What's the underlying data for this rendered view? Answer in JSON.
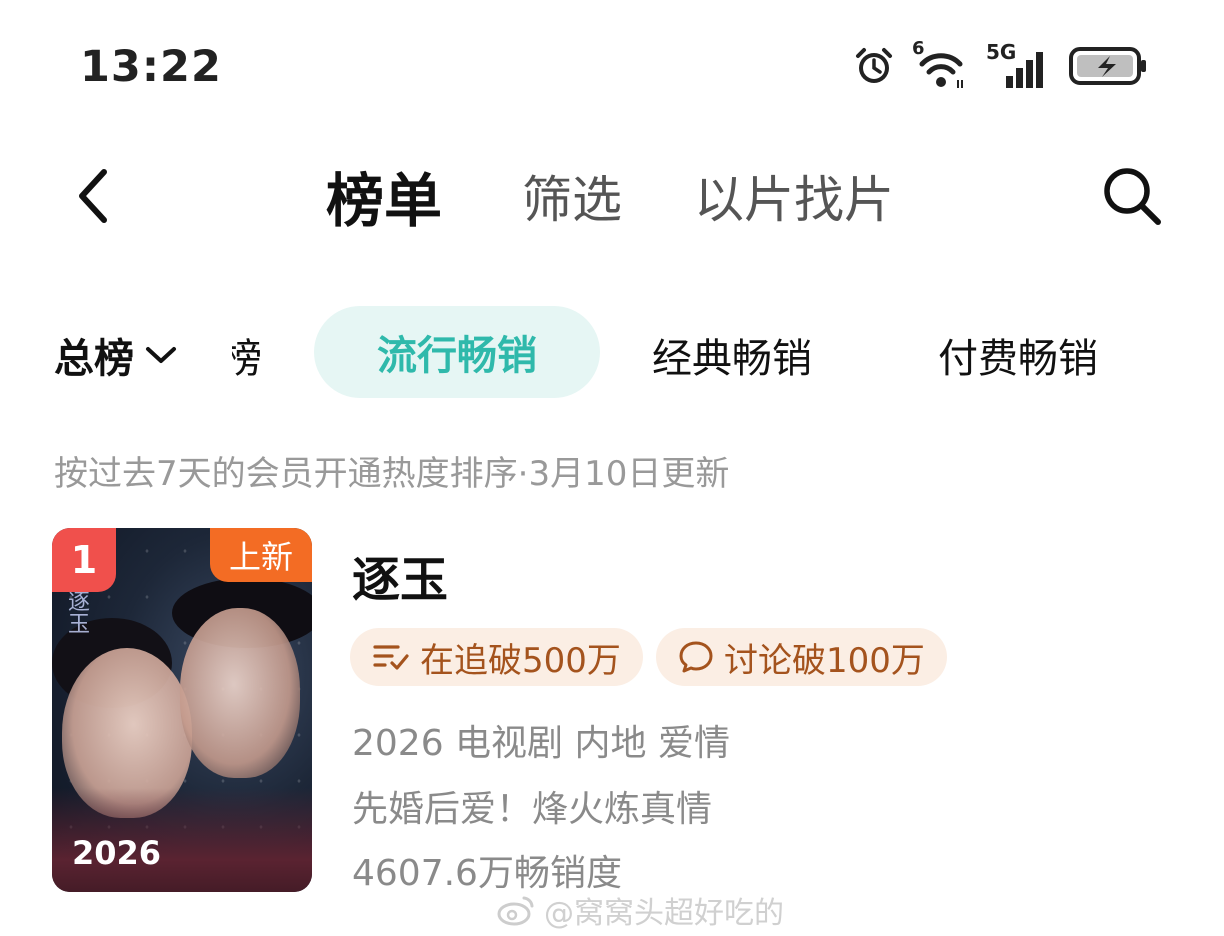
{
  "status_bar": {
    "time": "13:22",
    "wifi_label": "6",
    "signal_label": "5G",
    "icons": [
      "alarm-icon",
      "wifi-icon",
      "signal-icon",
      "battery-charging-icon"
    ]
  },
  "header": {
    "tabs": [
      {
        "label": "榜单",
        "active": true
      },
      {
        "label": "筛选",
        "active": false
      },
      {
        "label": "以片找片",
        "active": false
      }
    ],
    "back_icon": "chevron-left-icon",
    "search_icon": "search-icon"
  },
  "categories": {
    "main_label": "总榜",
    "cut_label": "榜",
    "tabs": [
      {
        "label": "流行畅销",
        "active": true
      },
      {
        "label": "经典畅销",
        "active": false
      },
      {
        "label": "付费畅销",
        "active": false
      }
    ],
    "accent": "#2fb9ab"
  },
  "note": "按过去7天的会员开通热度排序·3月10日更新",
  "items": [
    {
      "rank": "1",
      "badge": "上新",
      "poster_year": "2026",
      "poster_calligraphy": "逐玉",
      "title": "逐玉",
      "tags": [
        {
          "icon": "follow-list-icon",
          "label": "在追破500万"
        },
        {
          "icon": "comment-icon",
          "label": "讨论破100万"
        }
      ],
      "info": "2026 电视剧 内地 爱情",
      "tagline": "先婚后爱！烽火炼真情",
      "sales": "4607.6万畅销度"
    }
  ],
  "watermark": "@窝窝头超好吃的",
  "colors": {
    "rank_bg": "#f0504c",
    "new_badge_bg": "#f36c24",
    "tag_bg": "#fbeee4",
    "tag_text": "#a4531d"
  }
}
